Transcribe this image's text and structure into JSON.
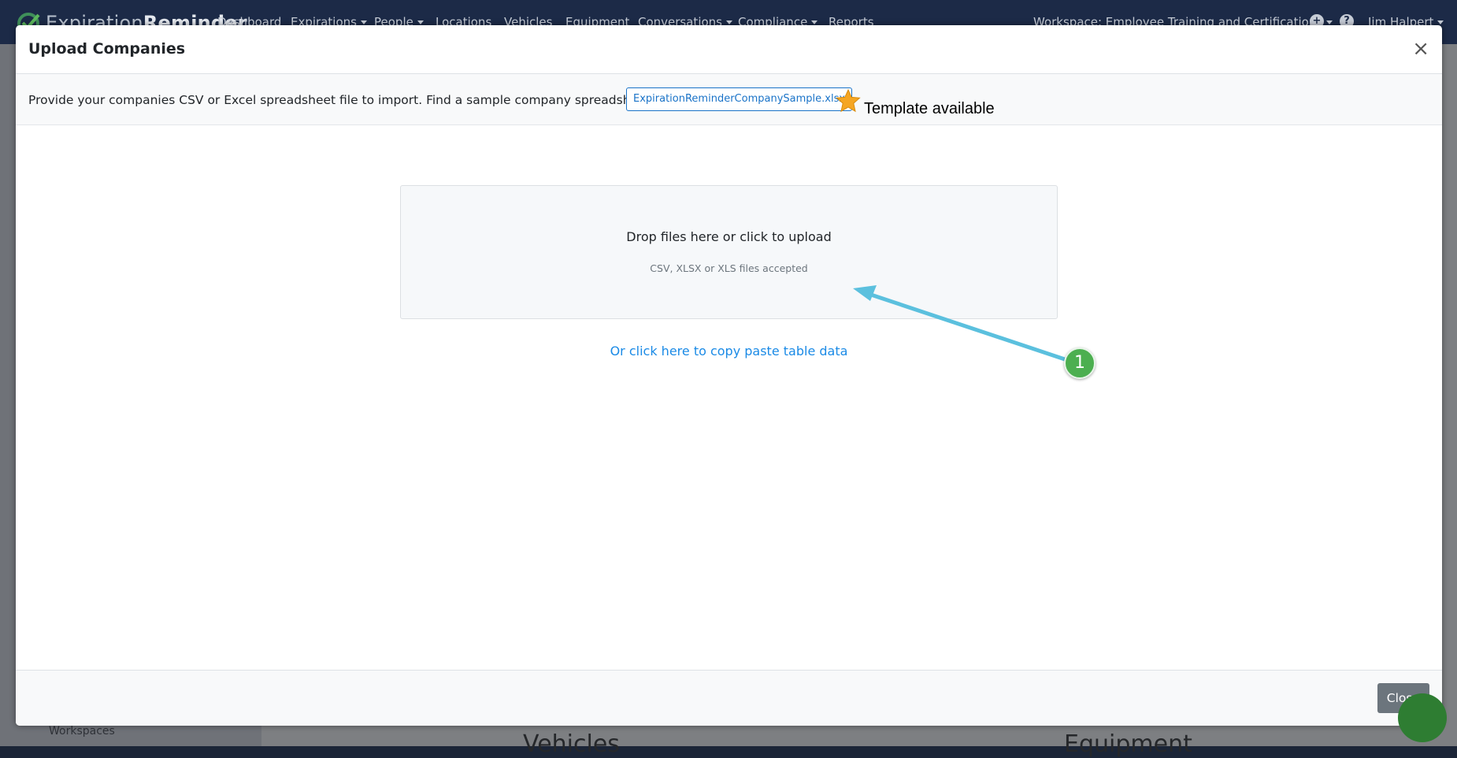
{
  "app": {
    "logo_light": "Expiration",
    "logo_bold": "Reminder",
    "nav": [
      "Dashboard",
      "Expirations",
      "People",
      "Locations",
      "Vehicles",
      "Equipment",
      "Conversations",
      "Compliance",
      "Reports"
    ],
    "workspace": "Workspace: Employee Training and Certifications",
    "user": "Jim Halpert",
    "sidebar_item": "Workspaces",
    "bg_headings": [
      "Vehicles",
      "Equipment"
    ]
  },
  "modal": {
    "title": "Upload Companies",
    "close_symbol": "×",
    "intro": "Provide your companies CSV or Excel spreadsheet file to import. Find a sample company spreadsheet here:",
    "sample_file": "ExpirationReminderCompanySample.xlsx",
    "template_note": "Template available",
    "dropzone_main": "Drop files here or click to upload",
    "dropzone_sub": "CSV, XLSX or XLS files accepted",
    "paste_link": "Or click here to copy paste table data",
    "step_badge": "1",
    "close_button": "Close"
  },
  "colors": {
    "accent": "#1a73c8",
    "annotation_arrow": "#5bc0de",
    "badge": "#4caf50",
    "star": "#f5a623"
  }
}
